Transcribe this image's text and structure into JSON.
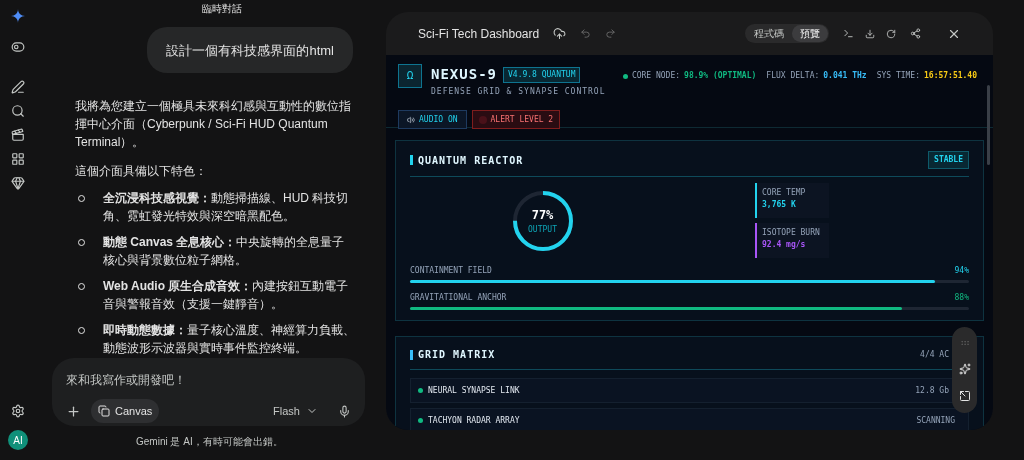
{
  "chat": {
    "title": "臨時對話",
    "user_message": "設計一個有科技感界面的html",
    "intro": "我將為您建立一個極具未來科幻感與互動性的數位指揮中心介面（Cyberpunk / Sci-Fi HUD Quantum Terminal）。",
    "lead": "這個介面具備以下特色：",
    "features": [
      {
        "title": "全沉浸科技感視覺：",
        "text": "動態掃描線、HUD 科技切角、霓虹發光特效與深空暗黑配色。"
      },
      {
        "title": "動態 Canvas 全息核心：",
        "text": "中央旋轉的全息量子核心與背景數位粒子網格。"
      },
      {
        "title": "Web Audio 原生合成音效：",
        "text": "內建按鈕互動電子音與警報音效（支援一鍵靜音）。"
      },
      {
        "title": "即時動態數據：",
        "text": "量子核心溫度、神經算力負載、動態波形示波器與實時事件監控終端。"
      }
    ]
  },
  "composer": {
    "placeholder": "來和我寫作或開發吧！",
    "tool": "Canvas",
    "model": "Flash"
  },
  "disclaimer": "Gemini 是 AI，有時可能會出錯。",
  "avatar": "AI",
  "canvas": {
    "title": "Sci-Fi Tech Dashboard",
    "view_tabs": [
      {
        "label": "程式碼",
        "selected": false
      },
      {
        "label": "預覽",
        "selected": true
      }
    ]
  },
  "dashboard": {
    "logo": "Ω",
    "name": "NEXUS-9",
    "version": "V4.9.8 QUANTUM",
    "subtitle": "DEFENSE GRID & SYNAPSE CONTROL",
    "status": [
      {
        "label": "CORE NODE:",
        "value": "98.9% (OPTIMAL)",
        "color": "#10b981"
      },
      {
        "label": "FLUX DELTA:",
        "value": "0.041 THz",
        "color": "#38bdf8"
      },
      {
        "label": "SYS TIME:",
        "value": "16:57:51.40",
        "color": "#facc15"
      }
    ],
    "audio_button": "AUDIO ON",
    "alert_button": "ALERT LEVEL 2",
    "reactor": {
      "title": "QUANTUM REACTOR",
      "badge": "STABLE",
      "gauge": {
        "value": "77%",
        "label": "OUTPUT",
        "level": 0.75
      },
      "stats": [
        {
          "label": "CORE TEMP",
          "value": "3,765 K",
          "color": "#22d3ee"
        },
        {
          "label": "ISOTOPE BURN",
          "value": "92.4 mg/s",
          "color": "#a855f7"
        }
      ],
      "bars": [
        {
          "label": "CONTAINMENT FIELD",
          "reading": "94%",
          "level": 0.94,
          "color": "#22d3ee"
        },
        {
          "label": "GRAVITATIONAL ANCHOR",
          "reading": "88%",
          "level": 0.88,
          "color": "#10b981"
        }
      ]
    },
    "grid": {
      "title": "GRID MATRIX",
      "count": "4/4 AC",
      "rows": [
        {
          "name": "NEURAL SYNAPSE LINK",
          "reading": "12.8 Gb",
          "color": "#10b981"
        },
        {
          "name": "TACHYON RADAR ARRAY",
          "reading": "SCANNING",
          "color": "#10b981"
        }
      ]
    }
  }
}
